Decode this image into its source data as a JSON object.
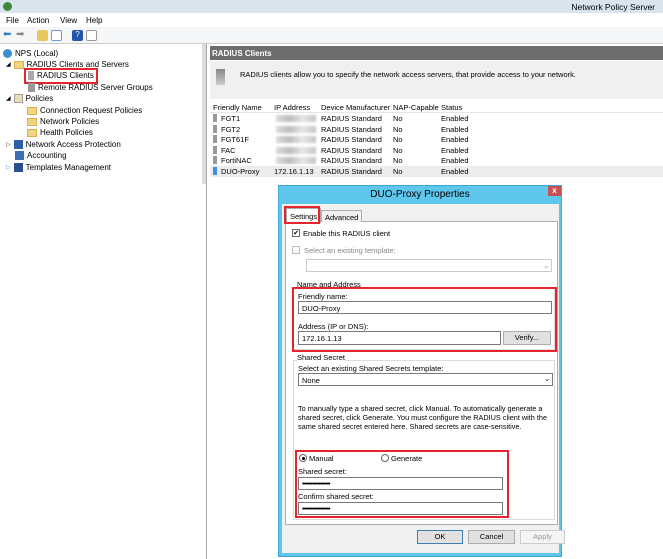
{
  "window": {
    "title": "Network Policy Server"
  },
  "menu": [
    "File",
    "Action",
    "View",
    "Help"
  ],
  "tree": {
    "root": "NPS (Local)",
    "items": [
      "RADIUS Clients and Servers",
      "RADIUS Clients",
      "Remote RADIUS Server Groups",
      "Policies",
      "Connection Request Policies",
      "Network Policies",
      "Health Policies",
      "Network Access Protection",
      "Accounting",
      "Templates Management"
    ]
  },
  "main": {
    "header": "RADIUS Clients",
    "description": "RADIUS clients allow you to specify the network access servers, that provide access to your network.",
    "columns": [
      "Friendly Name",
      "IP Address",
      "Device Manufacturer",
      "NAP-Capable",
      "Status"
    ],
    "rows": [
      {
        "name": "FGT1",
        "ip": "",
        "mfr": "RADIUS Standard",
        "nap": "No",
        "status": "Enabled"
      },
      {
        "name": "FGT2",
        "ip": "",
        "mfr": "RADIUS Standard",
        "nap": "No",
        "status": "Enabled"
      },
      {
        "name": "FGT61F",
        "ip": "",
        "mfr": "RADIUS Standard",
        "nap": "No",
        "status": "Enabled"
      },
      {
        "name": "FAC",
        "ip": "",
        "mfr": "RADIUS Standard",
        "nap": "No",
        "status": "Enabled"
      },
      {
        "name": "FortiNAC",
        "ip": "",
        "mfr": "RADIUS Standard",
        "nap": "No",
        "status": "Enabled"
      },
      {
        "name": "DUO-Proxy",
        "ip": "172.16.1.13",
        "mfr": "RADIUS Standard",
        "nap": "No",
        "status": "Enabled"
      }
    ]
  },
  "dialog": {
    "title": "DUO-Proxy Properties",
    "close": "x",
    "tabs": [
      "Settings",
      "Advanced"
    ],
    "enable_label": "Enable this RADIUS client",
    "enabled": true,
    "template_label": "Select an existing template:",
    "template_value": "",
    "name_group": "Name and Address",
    "friendly_label": "Friendly name:",
    "friendly_value": "DUO-Proxy",
    "address_label": "Address (IP or DNS):",
    "address_value": "172.16.1.13",
    "verify": "Verify...",
    "secret_group": "Shared Secret",
    "secret_template_label": "Select an existing Shared Secrets template:",
    "secret_template_value": "None",
    "help": "To manually type a shared secret, click Manual. To automatically generate a shared secret, click Generate. You must configure the RADIUS client with the same shared secret entered here. Shared secrets are case-sensitive.",
    "manual": "Manual",
    "generate": "Generate",
    "selected_mode": "Manual",
    "secret_label": "Shared secret:",
    "secret_value": "•••••••••••••••••",
    "confirm_label": "Confirm shared secret:",
    "confirm_value": "•••••••••••••••••",
    "ok": "OK",
    "cancel": "Cancel",
    "apply": "Apply"
  },
  "colors": {
    "highlight": "#e3262e",
    "dialog_title": "#5fc6ec",
    "header": "#6d6d6d"
  }
}
